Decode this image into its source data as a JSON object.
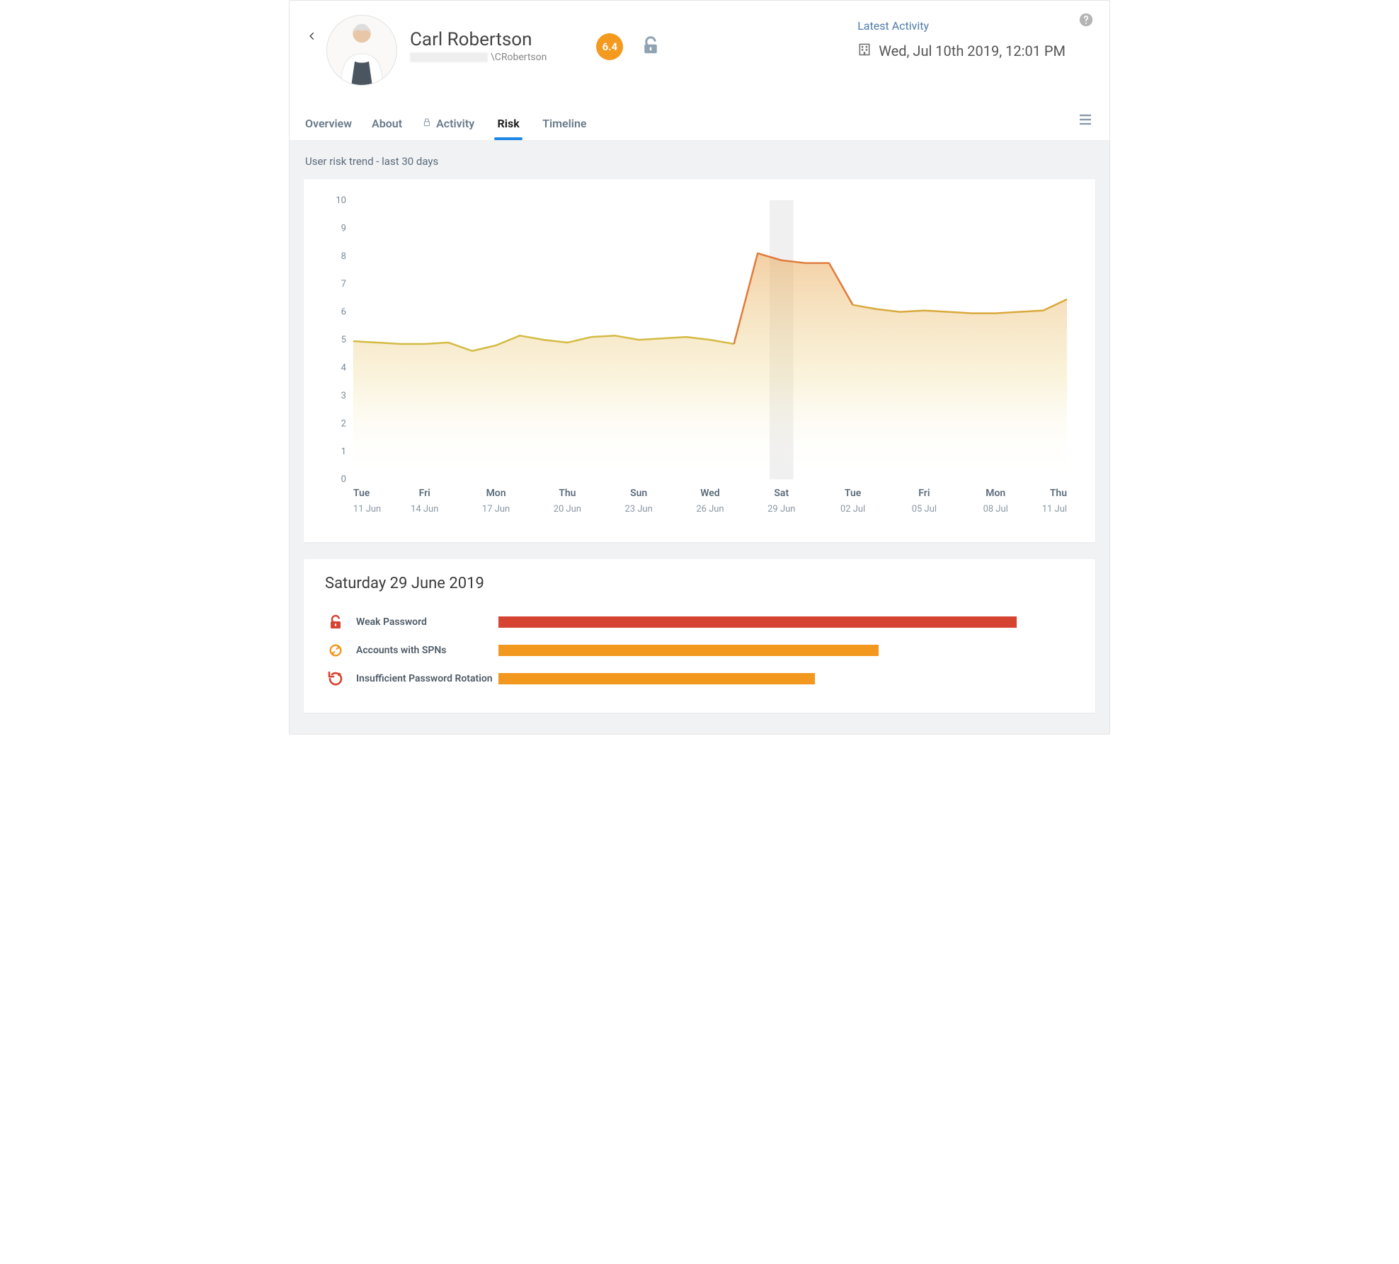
{
  "header": {
    "name": "Carl Robertson",
    "domain_suffix": "\\CRobertson",
    "risk_score": "6.4",
    "activity_label": "Latest Activity",
    "activity_date": "Wed, Jul 10th 2019, 12:01 PM"
  },
  "tabs": {
    "overview": "Overview",
    "about": "About",
    "activity": "Activity",
    "risk": "Risk",
    "timeline": "Timeline",
    "active": "Risk"
  },
  "colors": {
    "score_bg": "#f39a1f",
    "highlight_band": "rgba(0,0,0,0.06)",
    "bar_red": "#d64330",
    "bar_orange": "#f3981f",
    "line_low": "#d3bb42",
    "line_high": "#e07a3a",
    "accent": "#1e88e5"
  },
  "chart": {
    "title": "User risk trend - last 30 days",
    "ymin": 0,
    "ymax": 10,
    "highlight_index": 18
  },
  "chart_data": {
    "type": "area",
    "title": "User risk trend - last 30 days",
    "ylabel": "",
    "xlabel": "",
    "ylim": [
      0,
      10
    ],
    "x_tick_labels": [
      {
        "day": "Tue",
        "date": "11 Jun"
      },
      {
        "day": "Fri",
        "date": "14 Jun"
      },
      {
        "day": "Mon",
        "date": "17 Jun"
      },
      {
        "day": "Thu",
        "date": "20 Jun"
      },
      {
        "day": "Sun",
        "date": "23 Jun"
      },
      {
        "day": "Wed",
        "date": "26 Jun"
      },
      {
        "day": "Sat",
        "date": "29 Jun"
      },
      {
        "day": "Tue",
        "date": "02 Jul"
      },
      {
        "day": "Fri",
        "date": "05 Jul"
      },
      {
        "day": "Mon",
        "date": "08 Jul"
      },
      {
        "day": "Thu",
        "date": "11 Jul"
      }
    ],
    "x_tick_indices": [
      0,
      3,
      6,
      9,
      12,
      15,
      18,
      21,
      24,
      27,
      30
    ],
    "series": [
      {
        "name": "risk",
        "values": [
          4.95,
          4.9,
          4.85,
          4.85,
          4.9,
          4.6,
          4.8,
          5.15,
          5.0,
          4.9,
          5.1,
          5.15,
          5.0,
          5.05,
          5.1,
          5.0,
          4.85,
          8.1,
          7.85,
          7.75,
          7.75,
          6.25,
          6.1,
          6.0,
          6.05,
          6.0,
          5.95,
          5.95,
          6.0,
          6.05,
          6.45
        ]
      }
    ],
    "highlight_x_index": 18,
    "highlight_date": "Saturday 29 June 2019"
  },
  "detail": {
    "title": "Saturday 29 June 2019",
    "items": [
      {
        "label": "Weak Password",
        "icon": "unlock",
        "color": "#d64330",
        "width_pct": 90
      },
      {
        "label": "Accounts with SPNs",
        "icon": "circle-arrows",
        "color": "#f3981f",
        "width_pct": 66
      },
      {
        "label": "Insufficient Password Rotation",
        "icon": "rotate",
        "color": "#f3981f",
        "width_pct": 55
      }
    ]
  }
}
